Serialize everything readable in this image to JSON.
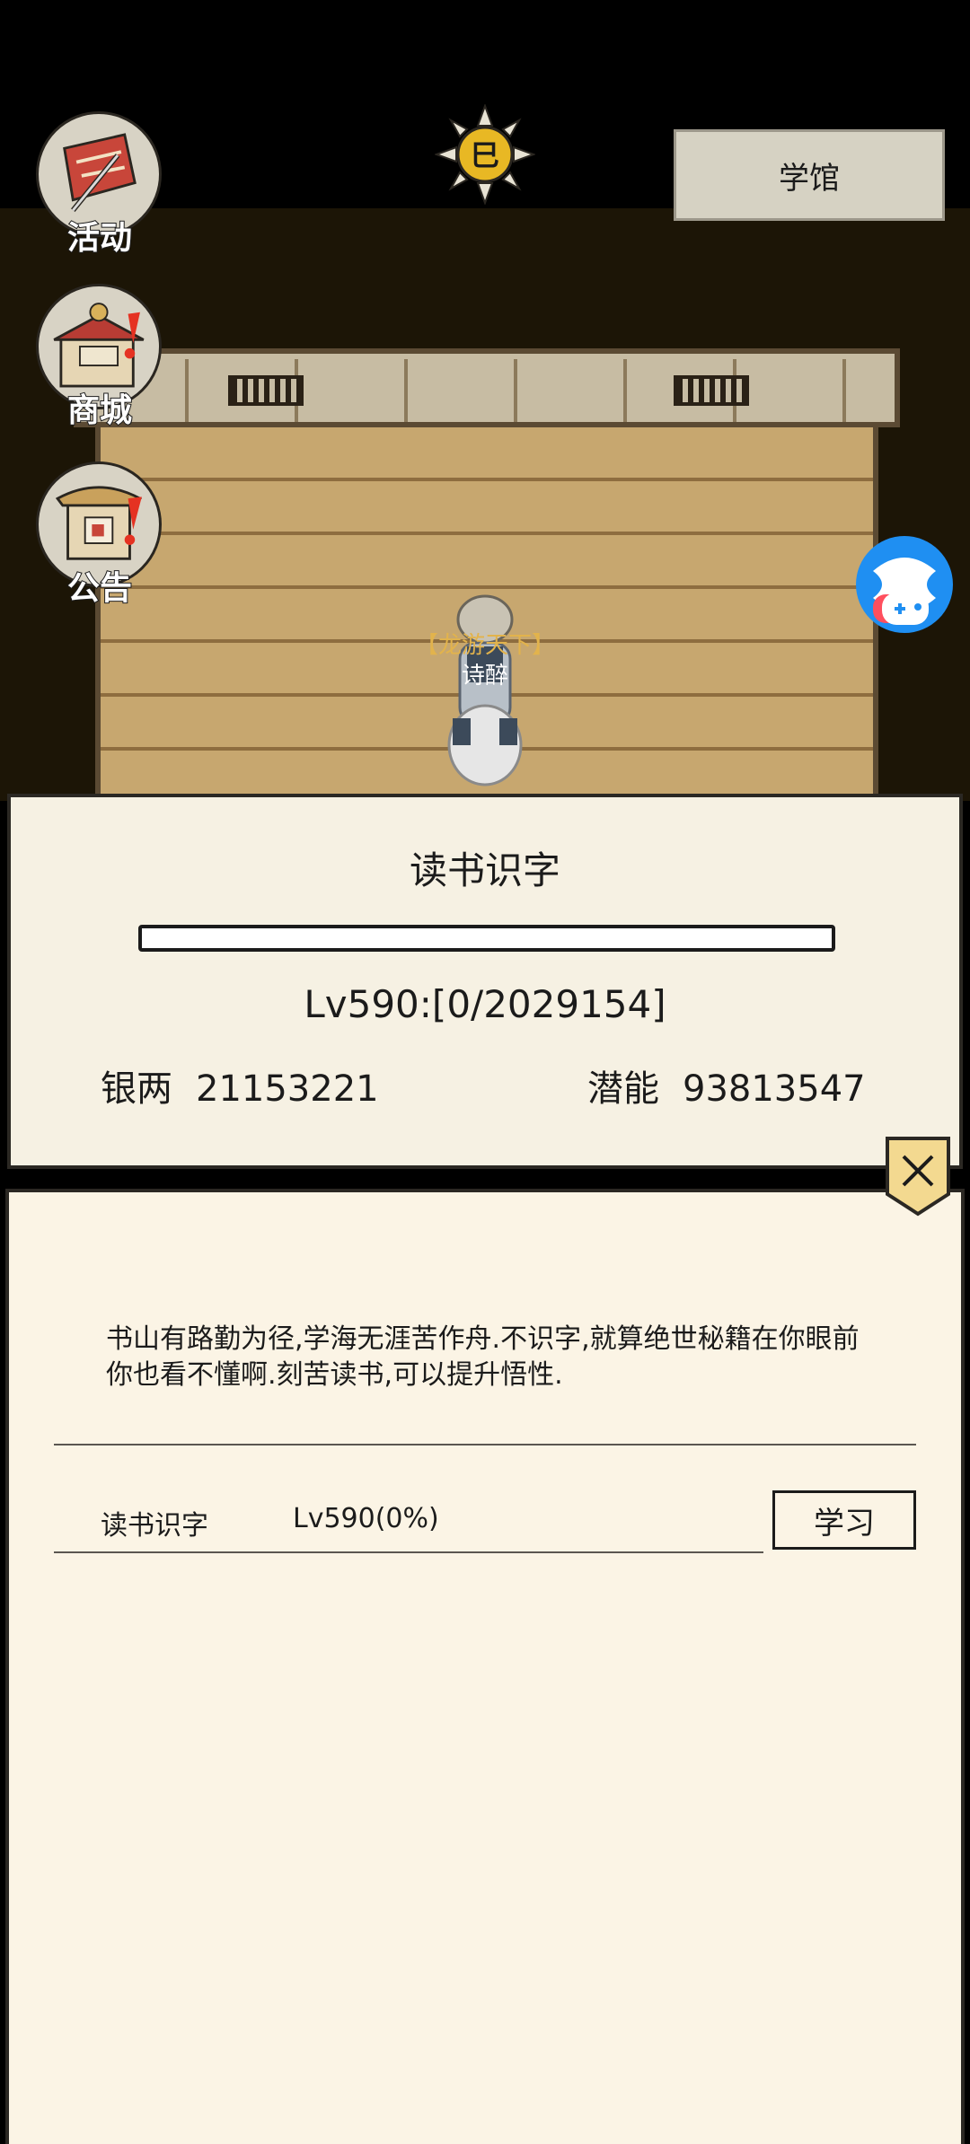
{
  "top_bar": {
    "academy_label": "学馆",
    "sun_glyph": "巳"
  },
  "side_menu": [
    {
      "label": "活动",
      "icon": "flag-sword-icon",
      "badge": false
    },
    {
      "label": "商城",
      "icon": "shop-icon",
      "badge": true
    },
    {
      "label": "公告",
      "icon": "notice-board-icon",
      "badge": true
    }
  ],
  "npc": {
    "title": "【龙游天下】",
    "name": "诗醉"
  },
  "panel": {
    "title": "读书识字",
    "progress_fraction": 0.0,
    "level_text": "Lv590:[0/2029154]",
    "stats": {
      "silver_label": "银两",
      "silver_value": "21153221",
      "potential_label": "潜能",
      "potential_value": "93813547"
    }
  },
  "detail": {
    "description": "书山有路勤为径,学海无涯苦作舟.不识字,就算绝世秘籍在你眼前你也看不懂啊.刻苦读书,可以提升悟性.",
    "skill_name": "读书识字",
    "skill_level": "Lv590(0%)",
    "learn_label": "学习"
  },
  "colors": {
    "panel_bg": "#f6f1e3",
    "detail_bg": "#fbf4e5",
    "scene_bg": "#1c1506",
    "accent_gold": "#e2b34c"
  }
}
